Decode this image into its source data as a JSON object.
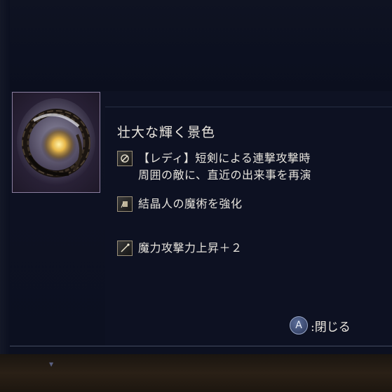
{
  "item": {
    "name": "壮大な輝く景色",
    "image_icon": "glowing-orb-nest-icon"
  },
  "effects": [
    {
      "icon": "sword-swirl-icon",
      "lines": [
        "【レディ】短剣による連撃攻撃時",
        "周囲の敵に、直近の出来事を再演"
      ]
    },
    {
      "icon": "crystal-icon",
      "lines": [
        "結晶人の魔術を強化"
      ]
    },
    {
      "icon": "staff-icon",
      "lines": [
        "魔力攻撃力上昇＋２"
      ]
    }
  ],
  "controls": {
    "close_button_glyph": "A",
    "close_label": ":閉じる"
  }
}
